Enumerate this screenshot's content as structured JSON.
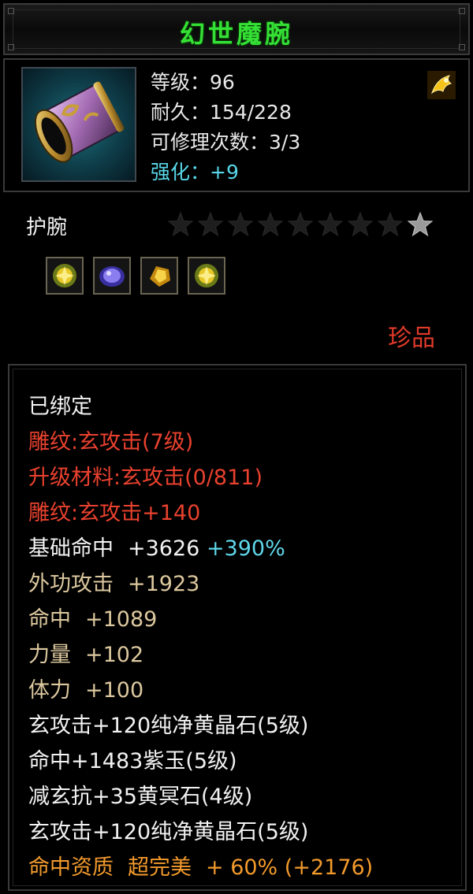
{
  "title": "幻世魔腕",
  "header": {
    "icon": "bracer-item-icon",
    "quality_icon": "gold-dragon-icon",
    "level": "等级：96",
    "durability": "耐久：154/228",
    "repair_count": "可修理次数：3/3",
    "enhance_label": "强化：",
    "enhance_value": "+9"
  },
  "type_label": "护腕",
  "stars": {
    "total": 9,
    "lit": 1
  },
  "gems": [
    "yellow-crystal-gem-icon",
    "purple-jade-gem-icon",
    "gold-stone-gem-icon",
    "yellow-crystal-gem-icon"
  ],
  "rarity": "珍品",
  "attributes": {
    "bound": "已绑定",
    "engrave1": "雕纹:玄攻击(7级)",
    "upgrade_material": "升级材料:玄攻击(0/811)",
    "engrave2": "雕纹:玄攻击+140",
    "base_hit_label": "基础命中",
    "base_hit_value": "+3626",
    "base_hit_pct": "+390%",
    "ext_attack_label": "外功攻击",
    "ext_attack_value": "+1923",
    "hit_label": "命中",
    "hit_value": "+1089",
    "strength_label": "力量",
    "strength_value": "+102",
    "stamina_label": "体力",
    "stamina_value": "+100",
    "gem_line1": "玄攻击+120纯净黄晶石(5级)",
    "gem_line2": "命中+1483紫玉(5级)",
    "gem_line3": "减玄抗+35黄冥石(4级)",
    "gem_line4": "玄攻击+120纯净黄晶石(5级)",
    "aptitude_label": "命中资质",
    "aptitude_grade": "超完美",
    "aptitude_value": "+ 60% (+2176)"
  },
  "colors": {
    "title": "#35e035",
    "red": "#e9412e",
    "tan": "#dcc89e",
    "cyan": "#5fd7ea",
    "orange": "#f39a2c"
  }
}
